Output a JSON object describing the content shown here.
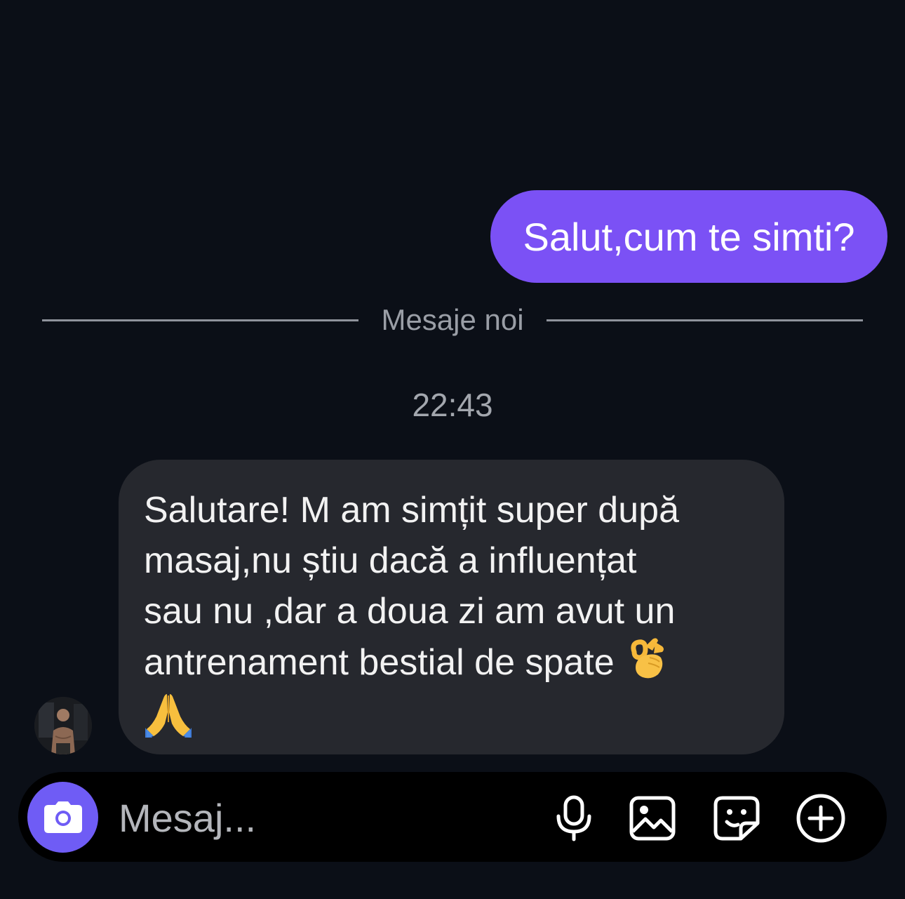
{
  "conversation": {
    "sent_message": "Salut,cum te simti?",
    "divider_label": "Mesaje noi",
    "timestamp": "22:43",
    "received_message": "Salutare! M am simțit super după\nmasaj,nu știu dacă a influențat\nsau nu ,dar a doua zi am avut un\nantrenament bestial de spate ",
    "received_emoji_1": "ok-hand-emoji",
    "received_emoji_2": "folded-hands-emoji"
  },
  "composer": {
    "placeholder": "Mesaj..."
  },
  "icons": {
    "camera": "camera-icon",
    "microphone": "microphone-icon",
    "gallery": "image-icon",
    "sticker": "sticker-icon",
    "more": "plus-circle-icon"
  },
  "colors": {
    "background": "#0b0f17",
    "sent_bubble": "#7b51f5",
    "received_bubble": "#26282e",
    "camera_button": "#6f5cf5",
    "composer": "#000000"
  }
}
